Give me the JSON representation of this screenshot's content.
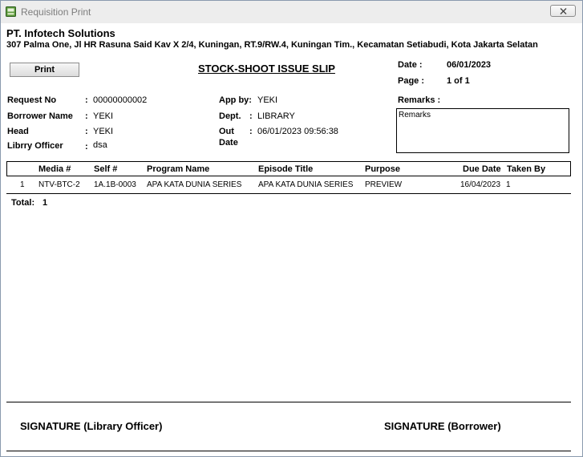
{
  "window": {
    "title": "Requisition Print"
  },
  "company": {
    "name": "PT. Infotech Solutions",
    "address": "307 Palma One, Jl HR Rasuna Said Kav X 2/4, Kuningan, RT.9/RW.4, Kuningan Tim., Kecamatan Setiabudi, Kota Jakarta Selatan"
  },
  "toolbar": {
    "print_label": "Print"
  },
  "slip": {
    "title": "STOCK-SHOOT ISSUE SLIP",
    "date_label": "Date :",
    "date_value": "06/01/2023",
    "page_label": "Page :",
    "page_value": "1 of 1"
  },
  "details": {
    "request_no_label": "Request No",
    "request_no": "00000000002",
    "borrower_name_label": "Borrower Name",
    "borrower_name": "YEKI",
    "head_label": "Head",
    "head": "YEKI",
    "library_officer_label": "Librry Officer",
    "library_officer": "dsa",
    "app_by_label": "App by:",
    "app_by": "YEKI",
    "dept_label": "Dept.",
    "dept": "LIBRARY",
    "out_label": "Out",
    "out_date_label": "Date",
    "out_value": "06/01/2023 09:56:38",
    "remarks_label": "Remarks :",
    "remarks_value": "Remarks",
    "colon": ":"
  },
  "table": {
    "headers": {
      "media": "Media #",
      "self": "Self #",
      "program": "Program Name",
      "episode": "Episode Title",
      "purpose": "Purpose",
      "due_date": "Due Date",
      "taken_by": "Taken By"
    },
    "rows": [
      {
        "no": "1",
        "media": "NTV-BTC-2",
        "self": "1A.1B-0003",
        "program": "APA KATA DUNIA SERIES",
        "episode": "APA KATA DUNIA SERIES",
        "purpose": "PREVIEW",
        "due_date": "16/04/2023",
        "taken_by": "1"
      }
    ],
    "total_label": "Total:",
    "total_value": "1"
  },
  "signatures": {
    "library_officer": "SIGNATURE (Library Officer)",
    "borrower": "SIGNATURE (Borrower)"
  }
}
